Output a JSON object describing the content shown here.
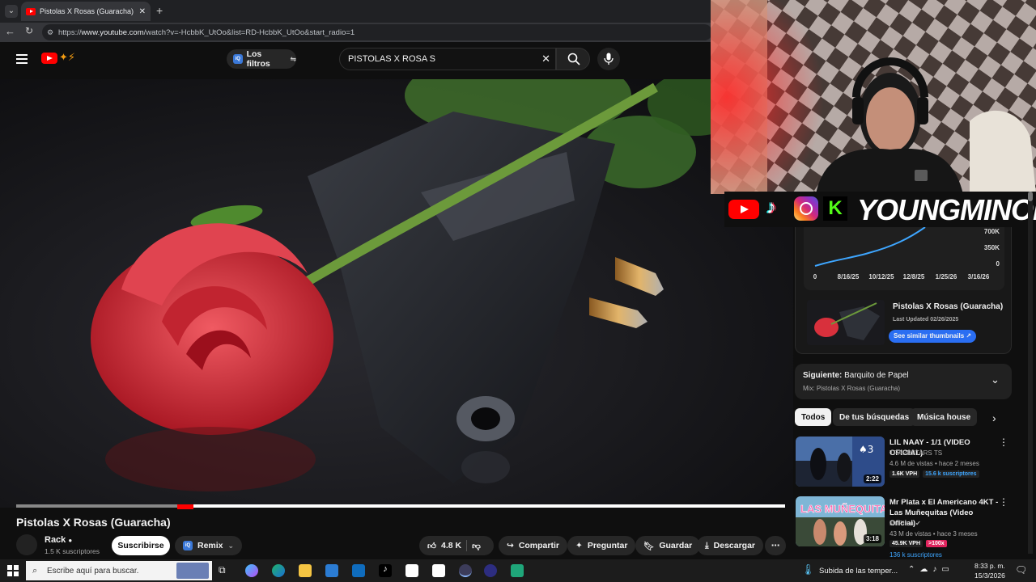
{
  "browser": {
    "tab_title": "Pistolas X Rosas (Guaracha) - YouTube",
    "new_tab": "+",
    "url_prefix": "https://",
    "url_domain": "www.youtube.com",
    "url_path": "/watch?v=-HcbbK_UtOo&list=RD-HcbbK_UtOo&start_radio=1"
  },
  "header": {
    "filters_label": "Los filtros",
    "search_value": "PISTOLAS X ROSA S"
  },
  "video": {
    "title": "Pistolas X Rosas (Guaracha)",
    "channel": "Rack",
    "subscribers": "1.5 K suscriptores",
    "subscribe_label": "Suscribirse",
    "remix_label": "Remix",
    "likes": "4.8 K",
    "share_label": "Compartir",
    "ask_label": "Preguntar",
    "save_label": "Guardar",
    "download_label": "Descargar",
    "progress_fraction": 0.23
  },
  "overlay": {
    "streamer_name": "YOUNGMINOR",
    "social_icons": [
      "youtube-icon",
      "tiktok-icon",
      "instagram-icon",
      "kick-icon"
    ]
  },
  "stats_panel": {
    "y_ticks": [
      "700K",
      "350K",
      "0"
    ],
    "x_ticks": [
      "0",
      "8/16/25",
      "10/12/25",
      "12/8/25",
      "1/25/26",
      "3/16/26"
    ],
    "video_name": "Pistolas X Rosas (Guaracha)",
    "last_updated": "Last Updated 02/26/2025",
    "similar_button": "See similar thumbnails ↗"
  },
  "playlist": {
    "next_label": "Siguiente:",
    "next_title": "Barquito de Papel",
    "mix_title": "Mix: Pistolas X Rosas (Guaracha)"
  },
  "chips": [
    "Todos",
    "De tus búsquedas",
    "Música house"
  ],
  "recommendations": [
    {
      "title": "LIL NAAY - 1/1 (VIDEO OFICIAL)",
      "channel": "TRAPPSTARS TS",
      "meta": "4.6 M de vistas • hace 2 meses",
      "vph": "1.6K VPH",
      "subs": "15.6 k suscriptores",
      "duration": "2:22"
    },
    {
      "title": "Mr Plata x El Americano 4KT - Las Muñequitas (Video Oficial)",
      "channel": "Mr Plata",
      "meta": "43 M de vistas • hace 3 meses",
      "vph": "45.9K VPH",
      "multiplier": ">100x",
      "subs": "136 k suscriptores",
      "duration": "3:18"
    }
  ],
  "taskbar": {
    "search_placeholder": "Escribe aquí para buscar.",
    "weather": "Subida de las temper...",
    "time": "8:33 p. m.",
    "date": "15/3/2026"
  },
  "colors": {
    "youtube_red": "#ff0000",
    "accent_blue": "#3ea6ff",
    "background": "#0f0f0f"
  }
}
